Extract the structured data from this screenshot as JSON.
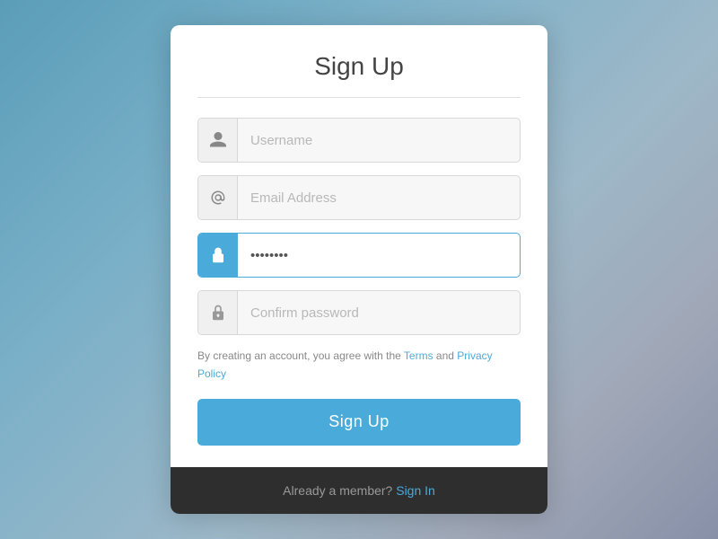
{
  "page": {
    "title": "Sign Up"
  },
  "form": {
    "username_placeholder": "Username",
    "email_placeholder": "Email Address",
    "password_placeholder": "••••••••",
    "confirm_placeholder": "Confirm password",
    "terms_text_before": "By creating an account, you agree with the ",
    "terms_link": "Terms",
    "terms_text_middle": " and ",
    "privacy_link": "Privacy Policy",
    "signup_button": "Sign Up"
  },
  "footer": {
    "already_member": "Already a member?",
    "sign_in_link": "Sign In"
  },
  "icons": {
    "user": "user-icon",
    "email": "at-icon",
    "lock": "lock-icon",
    "lock_confirm": "lock-confirm-icon"
  }
}
